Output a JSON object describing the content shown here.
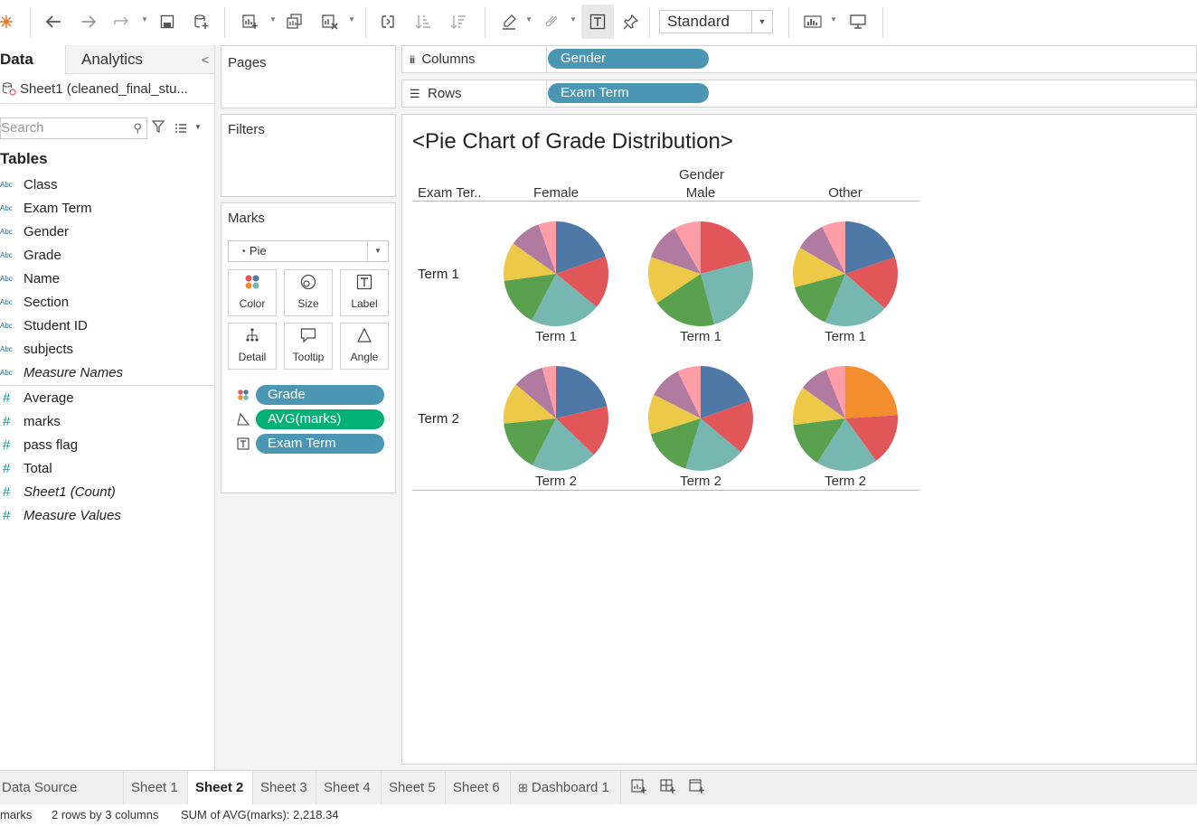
{
  "toolbar": {
    "view_size": "Standard",
    "icons": [
      "tableau-logo-icon",
      "undo-icon",
      "redo-icon",
      "replay-icon",
      "save-icon",
      "new-datasource-icon",
      "new-sheet-icon",
      "duplicate-sheet-icon",
      "clear-sheet-icon",
      "swap-icon",
      "sort-asc-icon",
      "sort-desc-icon",
      "highlight-icon",
      "group-icon",
      "show-labels-icon",
      "pin-icon",
      "show-me-icon",
      "presentation-icon"
    ]
  },
  "datapane": {
    "tab_data": "Data",
    "tab_analytics": "Analytics",
    "collapse": "<",
    "source": "Sheet1 (cleaned_final_stu...",
    "search_placeholder": "Search",
    "tables_heading": "Tables",
    "dimensions": [
      {
        "type": "Abc",
        "name": "Class"
      },
      {
        "type": "Abc",
        "name": "Exam Term"
      },
      {
        "type": "Abc",
        "name": "Gender"
      },
      {
        "type": "Abc",
        "name": "Grade"
      },
      {
        "type": "Abc",
        "name": "Name"
      },
      {
        "type": "Abc",
        "name": "Section"
      },
      {
        "type": "Abc",
        "name": "Student ID"
      },
      {
        "type": "Abc",
        "name": "subjects"
      },
      {
        "type": "Abc",
        "name": "Measure Names"
      }
    ],
    "measures": [
      {
        "type": "#",
        "name": "Average"
      },
      {
        "type": "#",
        "name": "marks"
      },
      {
        "type": "#",
        "name": "pass flag"
      },
      {
        "type": "#",
        "name": "Total"
      },
      {
        "type": "#",
        "name": "Sheet1 (Count)"
      },
      {
        "type": "#",
        "name": "Measure Values"
      }
    ]
  },
  "cards": {
    "pages": "Pages",
    "filters": "Filters",
    "marks": "Marks",
    "mark_type": "Pie",
    "mark_buttons": [
      "Color",
      "Size",
      "Label",
      "Detail",
      "Tooltip",
      "Angle"
    ],
    "mark_pills": [
      "Grade",
      "AVG(marks)",
      "Exam Term"
    ]
  },
  "shelves": {
    "columns_label": "Columns",
    "columns_pill": "Gender",
    "rows_label": "Rows",
    "rows_pill": "Exam Term"
  },
  "viz": {
    "title": "<Pie Chart of Grade Distribution>",
    "column_header_title": "Gender",
    "row_header_title": "Exam Ter..",
    "columns": [
      "Female",
      "Male",
      "Other"
    ],
    "rows": [
      "Term 1",
      "Term 2"
    ]
  },
  "chart_data": {
    "type": "pie",
    "title": "<Pie Chart of Grade Distribution>",
    "grid": [
      {
        "row": "Term 1",
        "column": "Female",
        "label": "Term 1",
        "slices": [
          {
            "color": "#4e79a7",
            "value": 18
          },
          {
            "color": "#e15759",
            "value": 15
          },
          {
            "color": "#76b7b2",
            "value": 20
          },
          {
            "color": "#59a14f",
            "value": 14
          },
          {
            "color": "#edc948",
            "value": 11
          },
          {
            "color": "#b07aa1",
            "value": 9
          },
          {
            "color": "#ff9da7",
            "value": 5
          }
        ]
      },
      {
        "row": "Term 1",
        "column": "Male",
        "label": "Term 1",
        "slices": [
          {
            "color": "#e15759",
            "value": 20
          },
          {
            "color": "#76b7b2",
            "value": 24
          },
          {
            "color": "#59a14f",
            "value": 19
          },
          {
            "color": "#edc948",
            "value": 14
          },
          {
            "color": "#b07aa1",
            "value": 11
          },
          {
            "color": "#ff9da7",
            "value": 8
          }
        ]
      },
      {
        "row": "Term 1",
        "column": "Other",
        "label": "Term 1",
        "slices": [
          {
            "color": "#4e79a7",
            "value": 19
          },
          {
            "color": "#e15759",
            "value": 16
          },
          {
            "color": "#76b7b2",
            "value": 19
          },
          {
            "color": "#59a14f",
            "value": 14
          },
          {
            "color": "#edc948",
            "value": 12
          },
          {
            "color": "#b07aa1",
            "value": 9
          },
          {
            "color": "#ff9da7",
            "value": 7
          }
        ]
      },
      {
        "row": "Term 2",
        "column": "Female",
        "label": "Term 2",
        "slices": [
          {
            "color": "#4e79a7",
            "value": 20
          },
          {
            "color": "#e15759",
            "value": 15
          },
          {
            "color": "#76b7b2",
            "value": 19
          },
          {
            "color": "#59a14f",
            "value": 15
          },
          {
            "color": "#edc948",
            "value": 12
          },
          {
            "color": "#b07aa1",
            "value": 9
          },
          {
            "color": "#ff9da7",
            "value": 4
          }
        ]
      },
      {
        "row": "Term 2",
        "column": "Male",
        "label": "Term 2",
        "slices": [
          {
            "color": "#4e79a7",
            "value": 19
          },
          {
            "color": "#e15759",
            "value": 16
          },
          {
            "color": "#76b7b2",
            "value": 18
          },
          {
            "color": "#59a14f",
            "value": 15
          },
          {
            "color": "#edc948",
            "value": 12
          },
          {
            "color": "#b07aa1",
            "value": 10
          },
          {
            "color": "#ff9da7",
            "value": 7
          }
        ]
      },
      {
        "row": "Term 2",
        "column": "Other",
        "label": "Term 2",
        "slices": [
          {
            "color": "#f28e2b",
            "value": 24
          },
          {
            "color": "#e15759",
            "value": 16
          },
          {
            "color": "#76b7b2",
            "value": 19
          },
          {
            "color": "#59a14f",
            "value": 14
          },
          {
            "color": "#edc948",
            "value": 12
          },
          {
            "color": "#b07aa1",
            "value": 9
          },
          {
            "color": "#ff9da7",
            "value": 6
          }
        ]
      }
    ]
  },
  "sheet_tabs": {
    "items": [
      "Data Source",
      "Sheet 1",
      "Sheet 2",
      "Sheet 3",
      "Sheet 4",
      "Sheet 5",
      "Sheet 6",
      "Dashboard 1"
    ],
    "active": "Sheet 2"
  },
  "status": {
    "marks": "marks",
    "rows_cols": "2 rows by 3 columns",
    "sum": "SUM of AVG(marks): 2,218.34"
  }
}
